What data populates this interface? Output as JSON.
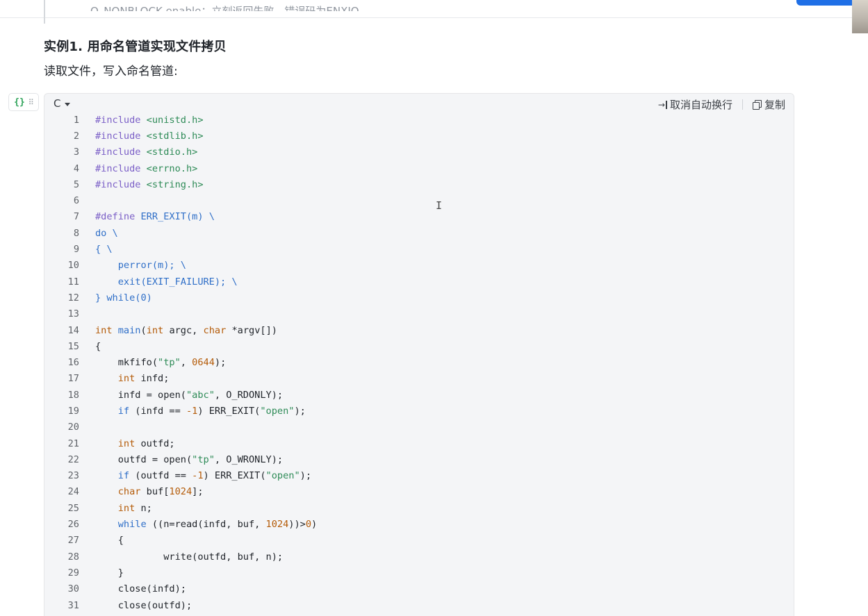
{
  "top": {
    "truncated_text": "O_NONBLOCK enable：立刻返回失败，错误码为ENXIO"
  },
  "section": {
    "heading": "实例1. 用命名管道实现文件拷贝",
    "paragraph": "读取文件，写入命名管道:"
  },
  "code_block": {
    "handle_icon": "{}",
    "language": "C",
    "wrap_label": "取消自动换行",
    "copy_label": "复制",
    "lines": [
      {
        "n": "1",
        "tokens": [
          [
            "pre",
            "#include "
          ],
          [
            "inc",
            "<unistd.h>"
          ]
        ]
      },
      {
        "n": "2",
        "tokens": [
          [
            "pre",
            "#include "
          ],
          [
            "inc",
            "<stdlib.h>"
          ]
        ]
      },
      {
        "n": "3",
        "tokens": [
          [
            "pre",
            "#include "
          ],
          [
            "inc",
            "<stdio.h>"
          ]
        ]
      },
      {
        "n": "4",
        "tokens": [
          [
            "pre",
            "#include "
          ],
          [
            "inc",
            "<errno.h>"
          ]
        ]
      },
      {
        "n": "5",
        "tokens": [
          [
            "pre",
            "#include "
          ],
          [
            "inc",
            "<string.h>"
          ]
        ]
      },
      {
        "n": "6",
        "tokens": []
      },
      {
        "n": "7",
        "tokens": [
          [
            "pre",
            "#define "
          ],
          [
            "mac",
            "ERR_EXIT(m) \\"
          ]
        ]
      },
      {
        "n": "8",
        "tokens": [
          [
            "mac",
            "do \\"
          ]
        ]
      },
      {
        "n": "9",
        "tokens": [
          [
            "mac",
            "{ \\"
          ]
        ]
      },
      {
        "n": "10",
        "tokens": [
          [
            "mac",
            "    perror(m); \\"
          ]
        ]
      },
      {
        "n": "11",
        "tokens": [
          [
            "mac",
            "    exit(EXIT_FAILURE); \\"
          ]
        ]
      },
      {
        "n": "12",
        "tokens": [
          [
            "mac",
            "} while(0)"
          ]
        ]
      },
      {
        "n": "13",
        "tokens": []
      },
      {
        "n": "14",
        "tokens": [
          [
            "type",
            "int "
          ],
          [
            "fn",
            "main"
          ],
          [
            "plain",
            "("
          ],
          [
            "type",
            "int "
          ],
          [
            "plain",
            "argc, "
          ],
          [
            "type",
            "char "
          ],
          [
            "plain",
            "*argv[])"
          ]
        ]
      },
      {
        "n": "15",
        "tokens": [
          [
            "plain",
            "{"
          ]
        ]
      },
      {
        "n": "16",
        "tokens": [
          [
            "plain",
            "    mkfifo("
          ],
          [
            "str",
            "\"tp\""
          ],
          [
            "plain",
            ", "
          ],
          [
            "num",
            "0644"
          ],
          [
            "plain",
            ");"
          ]
        ]
      },
      {
        "n": "17",
        "tokens": [
          [
            "type",
            "    int "
          ],
          [
            "plain",
            "infd;"
          ]
        ]
      },
      {
        "n": "18",
        "tokens": [
          [
            "plain",
            "    infd = open("
          ],
          [
            "str",
            "\"abc\""
          ],
          [
            "plain",
            ", O_RDONLY);"
          ]
        ]
      },
      {
        "n": "19",
        "tokens": [
          [
            "kw",
            "    if "
          ],
          [
            "plain",
            "(infd == "
          ],
          [
            "num",
            "-1"
          ],
          [
            "plain",
            ") ERR_EXIT("
          ],
          [
            "str",
            "\"open\""
          ],
          [
            "plain",
            ");"
          ]
        ]
      },
      {
        "n": "20",
        "tokens": []
      },
      {
        "n": "21",
        "tokens": [
          [
            "type",
            "    int "
          ],
          [
            "plain",
            "outfd;"
          ]
        ]
      },
      {
        "n": "22",
        "tokens": [
          [
            "plain",
            "    outfd = open("
          ],
          [
            "str",
            "\"tp\""
          ],
          [
            "plain",
            ", O_WRONLY);"
          ]
        ]
      },
      {
        "n": "23",
        "tokens": [
          [
            "kw",
            "    if "
          ],
          [
            "plain",
            "(outfd == "
          ],
          [
            "num",
            "-1"
          ],
          [
            "plain",
            ") ERR_EXIT("
          ],
          [
            "str",
            "\"open\""
          ],
          [
            "plain",
            ");"
          ]
        ]
      },
      {
        "n": "24",
        "tokens": [
          [
            "type",
            "    char "
          ],
          [
            "plain",
            "buf["
          ],
          [
            "num",
            "1024"
          ],
          [
            "plain",
            "];"
          ]
        ]
      },
      {
        "n": "25",
        "tokens": [
          [
            "type",
            "    int "
          ],
          [
            "plain",
            "n;"
          ]
        ]
      },
      {
        "n": "26",
        "tokens": [
          [
            "kw",
            "    while "
          ],
          [
            "plain",
            "((n=read(infd, buf, "
          ],
          [
            "num",
            "1024"
          ],
          [
            "plain",
            "))>"
          ],
          [
            "num",
            "0"
          ],
          [
            "plain",
            ")"
          ]
        ]
      },
      {
        "n": "27",
        "tokens": [
          [
            "plain",
            "    {"
          ]
        ]
      },
      {
        "n": "28",
        "tokens": [
          [
            "plain",
            "            write(outfd, buf, n);"
          ]
        ]
      },
      {
        "n": "29",
        "tokens": [
          [
            "plain",
            "    }"
          ]
        ]
      },
      {
        "n": "30",
        "tokens": [
          [
            "plain",
            "    close(infd);"
          ]
        ]
      },
      {
        "n": "31",
        "tokens": [
          [
            "plain",
            "    close(outfd);"
          ]
        ]
      }
    ]
  }
}
